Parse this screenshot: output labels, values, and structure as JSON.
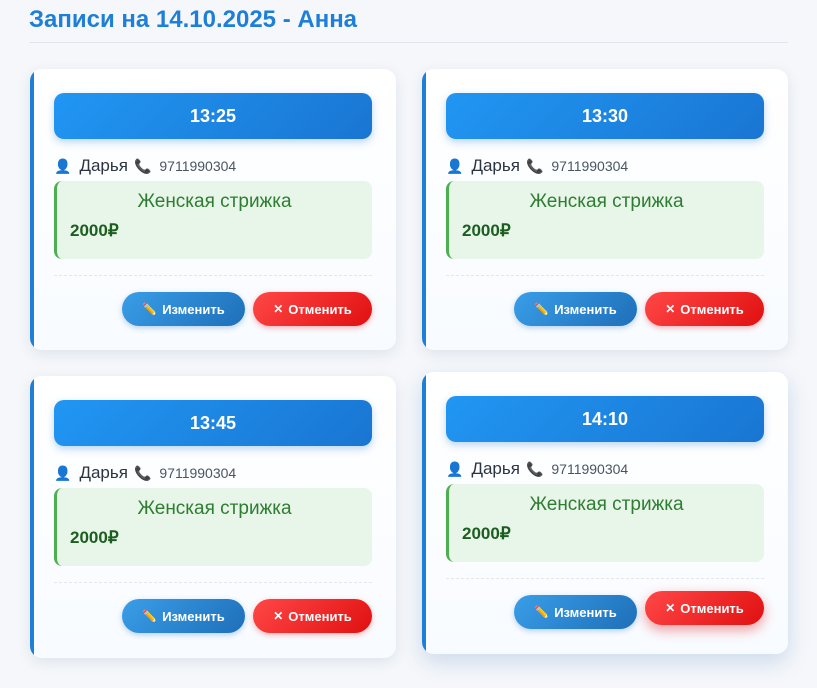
{
  "header": {
    "title": "Записи на 14.10.2025 - Анна"
  },
  "icons": {
    "person": "👤",
    "phone": "📞",
    "edit": "✏️",
    "cancel": "✕"
  },
  "colors": {
    "accent": "#1e7fd9",
    "edit_button": "#2a86d4",
    "cancel_button": "#f21f1f",
    "service_bg": "#e8f5e9",
    "service_text": "#2e7d32"
  },
  "appointments": [
    {
      "time": "13:25",
      "client": "Дарья",
      "phone": "9711990304",
      "service": "Женская стрижка",
      "price": "2000₽",
      "edit_label": "Изменить",
      "cancel_label": "Отменить"
    },
    {
      "time": "13:30",
      "client": "Дарья",
      "phone": "9711990304",
      "service": "Женская стрижка",
      "price": "2000₽",
      "edit_label": "Изменить",
      "cancel_label": "Отменить"
    },
    {
      "time": "13:45",
      "client": "Дарья",
      "phone": "9711990304",
      "service": "Женская стрижка",
      "price": "2000₽",
      "edit_label": "Изменить",
      "cancel_label": "Отменить"
    },
    {
      "time": "14:10",
      "client": "Дарья",
      "phone": "9711990304",
      "service": "Женская стрижка",
      "price": "2000₽",
      "edit_label": "Изменить",
      "cancel_label": "Отменить"
    }
  ]
}
